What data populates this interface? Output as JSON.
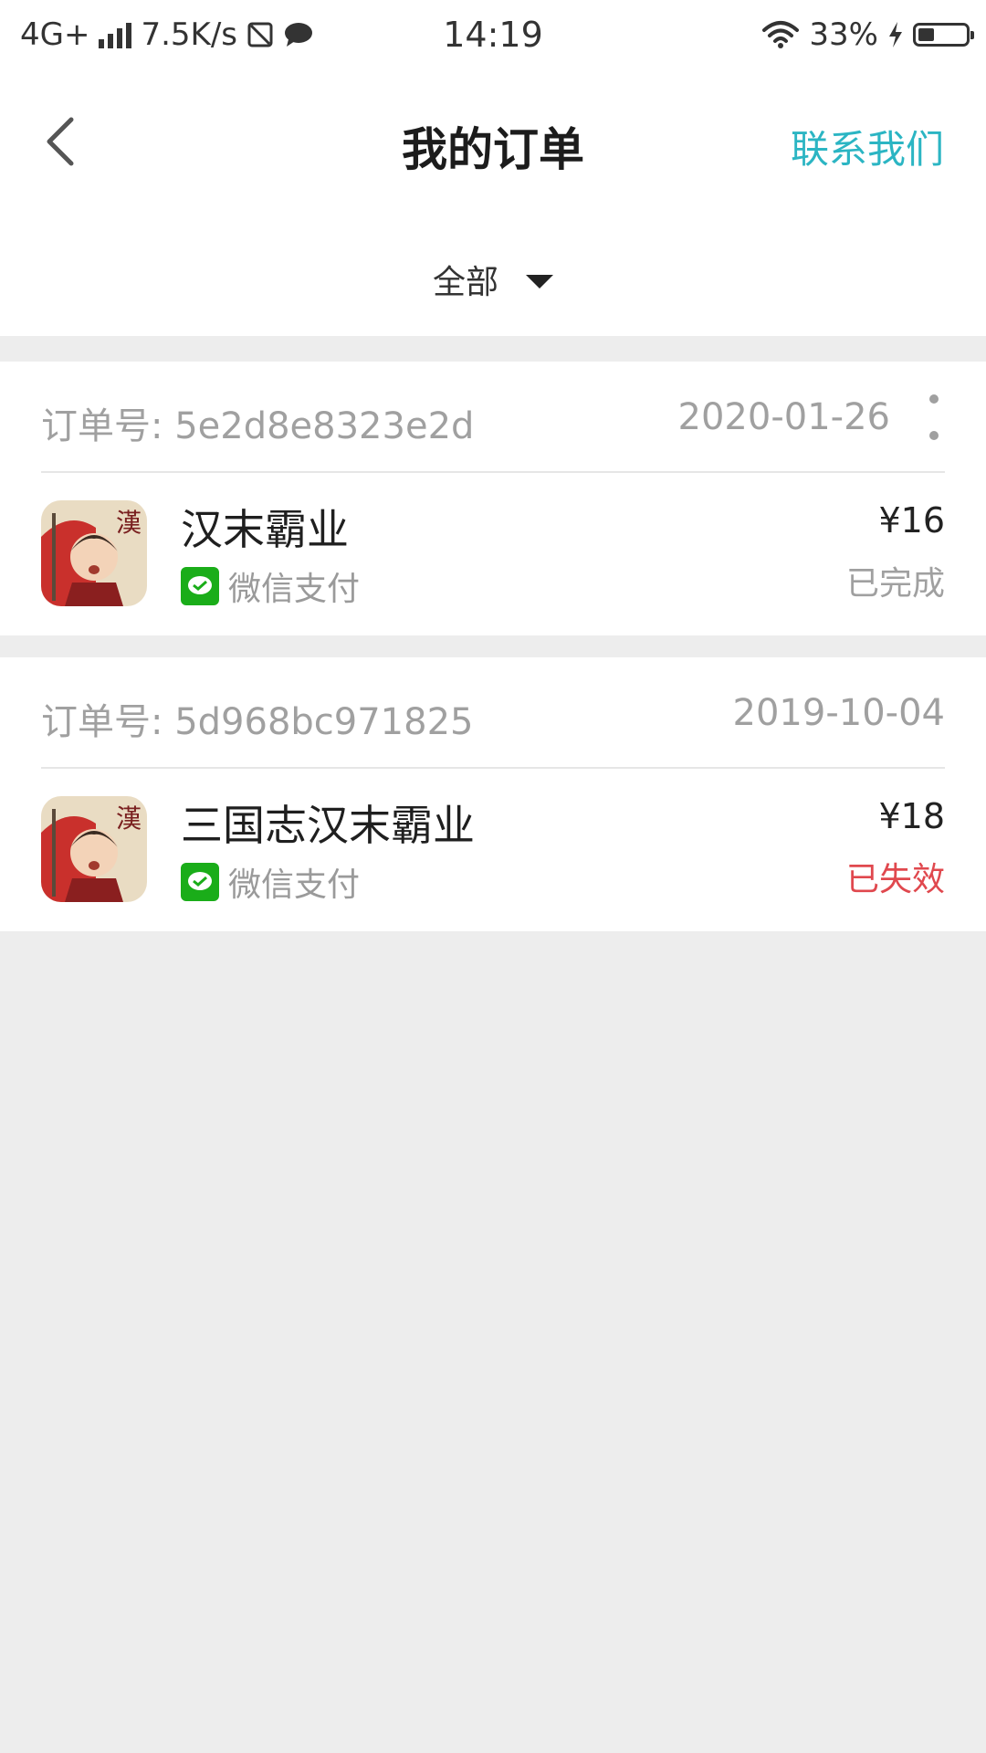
{
  "status_bar": {
    "network": "4G+",
    "speed": "7.5K/s",
    "time": "14:19",
    "battery_percent": "33%",
    "battery_level": 0.33
  },
  "nav": {
    "title": "我的订单",
    "contact_label": "联系我们"
  },
  "filter": {
    "label": "全部"
  },
  "orders": [
    {
      "order_no_prefix": "订单号:",
      "order_no": "5e2d8e8323e2d",
      "date": "2020-01-26",
      "game_name": "汉末霸业",
      "pay_method": "微信支付",
      "price": "¥16",
      "status": "已完成",
      "status_color": "#a0a0a0"
    },
    {
      "order_no_prefix": "订单号:",
      "order_no": "5d968bc971825",
      "date": "2019-10-04",
      "game_name": "三国志汉末霸业",
      "pay_method": "微信支付",
      "price": "¥18",
      "status": "已失效",
      "status_color": "#e0484e"
    }
  ],
  "game_icon_glyph": "漢",
  "colors": {
    "accent": "#2bb5c3",
    "background": "#ededed",
    "wechat_green": "#1aad19",
    "invalid_red": "#e0484e"
  }
}
